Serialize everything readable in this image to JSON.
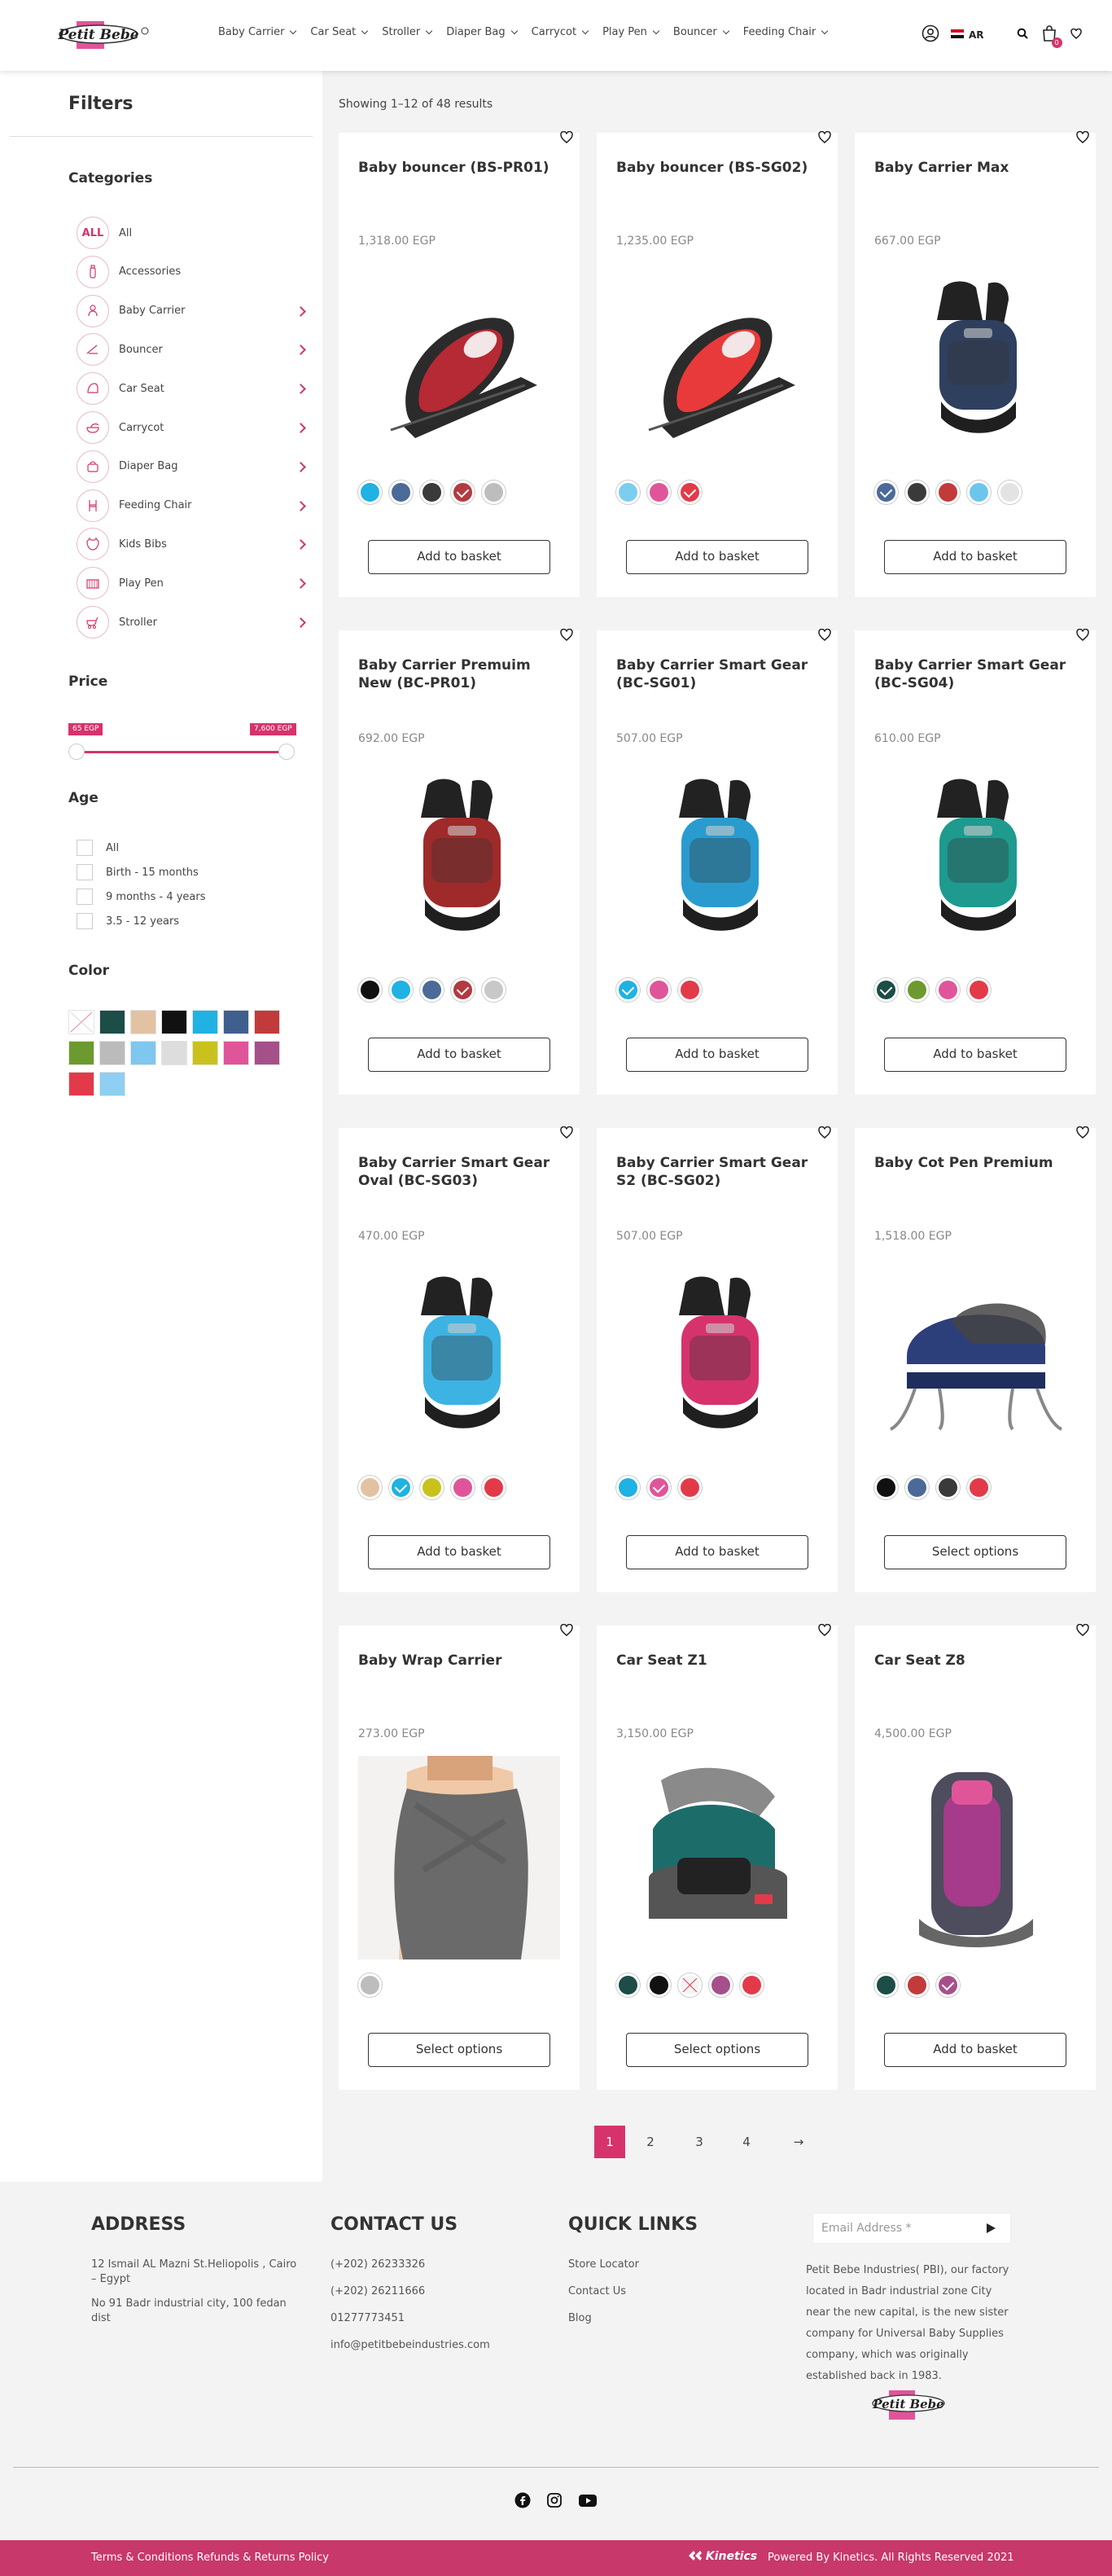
{
  "header": {
    "logo_text": "Petit Bebe",
    "nav": [
      "Baby Carrier",
      "Car Seat",
      "Stroller",
      "Diaper Bag",
      "Carrycot",
      "Play Pen",
      "Bouncer",
      "Feeding Chair"
    ],
    "language": "AR",
    "cart_count": "0",
    "icons": [
      "user-icon",
      "flag-icon",
      "search-icon",
      "cart-icon",
      "heart-icon"
    ]
  },
  "sidebar": {
    "title": "Filters",
    "categories_title": "Categories",
    "categories": [
      {
        "label": "All",
        "icon": "ALL"
      },
      {
        "label": "Accessories",
        "icon": "bottle-icon"
      },
      {
        "label": "Baby Carrier",
        "icon": "carrier-icon"
      },
      {
        "label": "Bouncer",
        "icon": "bouncer-icon"
      },
      {
        "label": "Car Seat",
        "icon": "car-seat-icon"
      },
      {
        "label": "Carrycot",
        "icon": "carrycot-icon"
      },
      {
        "label": "Diaper Bag",
        "icon": "diaper-bag-icon"
      },
      {
        "label": "Feeding Chair",
        "icon": "feeding-chair-icon"
      },
      {
        "label": "Kids Bibs",
        "icon": "bib-icon"
      },
      {
        "label": "Play Pen",
        "icon": "play-pen-icon"
      },
      {
        "label": "Stroller",
        "icon": "stroller-icon"
      }
    ],
    "price_title": "Price",
    "price_min": "65 EGP",
    "price_max": "7,600 EGP",
    "age_title": "Age",
    "ages": [
      "All",
      "Birth - 15 months",
      "9 months - 4 years",
      "3.5 - 12 years"
    ],
    "color_title": "Color",
    "colors": [
      "#ffffff",
      "#1c4d47",
      "#e3c2a3",
      "#111111",
      "#1fb2e3",
      "#3f5f8f",
      "#c23b3b",
      "#6d9a2e",
      "#bbbbbb",
      "#7fc7ee",
      "#dddddd",
      "#c9c21c",
      "#e0559a",
      "#a5508a",
      "#e33a4a",
      "#8ecff2"
    ]
  },
  "main": {
    "result_count": "Showing 1–12 of 48 results",
    "products": [
      {
        "title": "Baby bouncer (BS-PR01)",
        "price": "1,318.00 EGP",
        "button": "Add to basket",
        "image": "bouncer",
        "main": "#b52a34",
        "colors": [
          {
            "c": "#1fb2e3"
          },
          {
            "c": "#4b6a98"
          },
          {
            "c": "#3a3a3a"
          },
          {
            "c": "#b23a40",
            "sel": true
          },
          {
            "c": "#bdbdbd"
          }
        ]
      },
      {
        "title": "Baby bouncer (BS-SG02)",
        "price": "1,235.00 EGP",
        "button": "Add to basket",
        "image": "bouncer",
        "main": "#e83a3a",
        "colors": [
          {
            "c": "#7ccdf0"
          },
          {
            "c": "#e0559a"
          },
          {
            "c": "#e33a4a",
            "sel": true
          }
        ]
      },
      {
        "title": "Baby Carrier Max",
        "price": "667.00 EGP",
        "button": "Add to basket",
        "image": "carrier",
        "main": "#2f3f5e",
        "colors": [
          {
            "c": "#4b6a98",
            "sel": true
          },
          {
            "c": "#3a3a3a"
          },
          {
            "c": "#c23b3b"
          },
          {
            "c": "#6ec5ec"
          },
          {
            "c": "#e3e3e3"
          }
        ]
      },
      {
        "title": "Baby Carrier Premuim New (BC-PR01)",
        "price": "692.00 EGP",
        "button": "Add to basket",
        "image": "carrier",
        "main": "#9e2a2a",
        "colors": [
          {
            "c": "#111111"
          },
          {
            "c": "#1fb2e3"
          },
          {
            "c": "#4b6a98"
          },
          {
            "c": "#b23a40",
            "sel": true
          },
          {
            "c": "#c8c8c8"
          }
        ]
      },
      {
        "title": "Baby Carrier Smart Gear (BC-SG01)",
        "price": "507.00 EGP",
        "button": "Add to basket",
        "image": "carrier",
        "main": "#2a9bcf",
        "colors": [
          {
            "c": "#1fb2e3",
            "sel": true
          },
          {
            "c": "#e0559a"
          },
          {
            "c": "#e33a4a"
          }
        ]
      },
      {
        "title": "Baby Carrier Smart Gear (BC-SG04)",
        "price": "610.00 EGP",
        "button": "Add to basket",
        "image": "carrier",
        "main": "#1e9a8e",
        "colors": [
          {
            "c": "#1c4d47",
            "sel": true
          },
          {
            "c": "#6d9a2e"
          },
          {
            "c": "#e0559a"
          },
          {
            "c": "#e33a4a"
          }
        ]
      },
      {
        "title": "Baby Carrier Smart Gear Oval (BC-SG03)",
        "price": "470.00 EGP",
        "button": "Add to basket",
        "image": "carrier",
        "main": "#3db3e3",
        "colors": [
          {
            "c": "#e3c2a3"
          },
          {
            "c": "#1fb2e3",
            "sel": true
          },
          {
            "c": "#c9c21c"
          },
          {
            "c": "#e0559a"
          },
          {
            "c": "#e33a4a"
          }
        ]
      },
      {
        "title": "Baby Carrier Smart Gear S2 (BC-SG02)",
        "price": "507.00 EGP",
        "button": "Add to basket",
        "image": "carrier",
        "main": "#d6336c",
        "colors": [
          {
            "c": "#1fb2e3"
          },
          {
            "c": "#e0559a",
            "sel": true
          },
          {
            "c": "#e33a4a"
          }
        ]
      },
      {
        "title": "Baby Cot Pen Premium",
        "price": "1,518.00 EGP",
        "button": "Select options",
        "image": "cot",
        "main": "#2d3f7a",
        "colors": [
          {
            "c": "#111111"
          },
          {
            "c": "#4b6a98"
          },
          {
            "c": "#3a3a3a"
          },
          {
            "c": "#e33a4a"
          }
        ]
      },
      {
        "title": "Baby Wrap Carrier",
        "price": "273.00 EGP",
        "button": "Select options",
        "image": "wrap",
        "main": "#6a6a6a",
        "colors": [
          {
            "c": "#bdbdbd"
          }
        ]
      },
      {
        "title": "Car Seat Z1",
        "price": "3,150.00 EGP",
        "button": "Select options",
        "image": "carseat",
        "main": "#1c6d6a",
        "colors": [
          {
            "c": "#1c4d47"
          },
          {
            "c": "#111111"
          },
          {
            "c": "#f4f4f4"
          },
          {
            "c": "#a5508a"
          },
          {
            "c": "#e33a4a"
          }
        ]
      },
      {
        "title": "Car Seat Z8",
        "price": "4,500.00 EGP",
        "button": "Add to basket",
        "image": "carseatz8",
        "main": "#a53b8a",
        "colors": [
          {
            "c": "#1c4d47"
          },
          {
            "c": "#c23b3b"
          },
          {
            "c": "#a5508a",
            "sel": true
          }
        ]
      }
    ],
    "pagination": [
      "1",
      "2",
      "3",
      "4",
      "→"
    ]
  },
  "footer": {
    "address_title": "ADDRESS",
    "address_lines": [
      "12 Ismail AL Mazni St.Heliopolis , Cairo – Egypt",
      "No 91 Badr industrial city, 100 fedan dist"
    ],
    "contact_title": "CONTACT US",
    "contact_lines": [
      "(+202) 26233326",
      "(+202) 26211666",
      "01277773451",
      "info@petitbebeindustries.com"
    ],
    "links_title": "QUICK LINKS",
    "links": [
      "Store Locator",
      "Contact Us",
      "Blog"
    ],
    "email_placeholder": "Email Address *",
    "about": "Petit Bebe Industries( PBI), our factory located in Badr industrial zone City near the new capital, is the new sister company for Universal Baby Supplies company, which was originally established back in 1983.",
    "bottom_left": "Terms & Conditions Refunds & Returns Policy",
    "brand": "Kinetics",
    "bottom_right": "Powered By Kinetics. All Rights Reserved 2021"
  }
}
